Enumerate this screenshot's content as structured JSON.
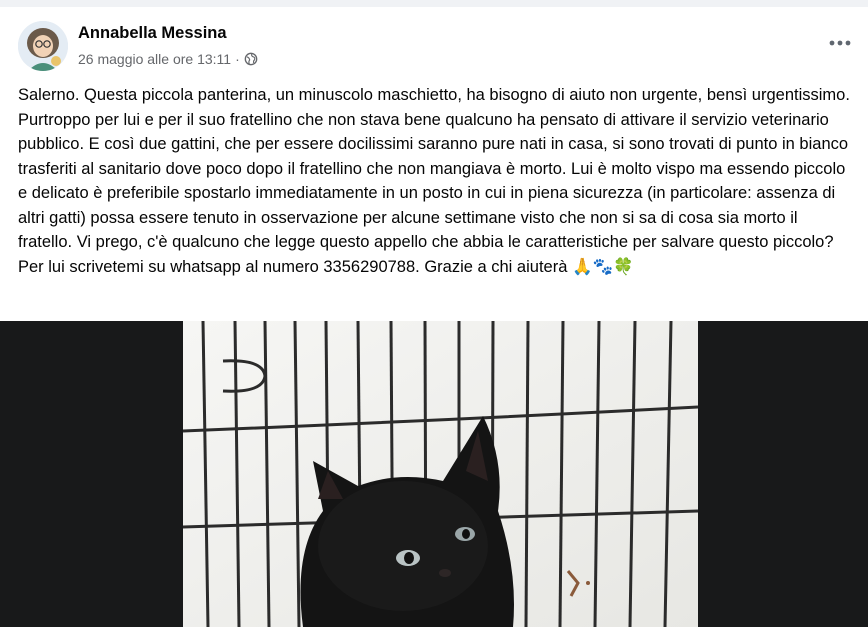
{
  "post": {
    "author": "Annabella Messina",
    "timestamp": "26 maggio alle ore 13:11",
    "separator": "·",
    "audience_icon": "globe-icon",
    "more_icon": "more-horizontal-icon",
    "text": "Salerno. Questa piccola panterina, un minuscolo maschietto, ha bisogno di aiuto non urgente, bensì urgentissimo. Purtroppo per lui e per il suo fratellino che non stava bene qualcuno ha pensato di attivare il servizio veterinario pubblico. E così due gattini, che per essere docilissimi saranno pure nati in casa, si sono trovati di punto in bianco trasferiti al sanitario dove poco dopo il fratellino che non mangiava è morto. Lui è molto vispo ma essendo piccolo e delicato è preferibile spostarlo immediatamente in un posto in cui in piena sicurezza (in particolare: assenza di altri gatti) possa essere tenuto in osservazione per alcune settimane visto che non si sa di cosa sia morto il fratello. Vi prego, c'è qualcuno che legge questo appello che abbia le caratteristiche per salvare questo piccolo? Per lui scrivetemi su whatsapp al numero 3356290788. Grazie a chi aiuterà 🙏🐾🍀",
    "photo_subject": "black kitten in a wire cage"
  },
  "colors": {
    "text_primary": "#050505",
    "text_secondary": "#65676b",
    "media_background": "#18191a",
    "page_divider": "#f0f2f5"
  }
}
